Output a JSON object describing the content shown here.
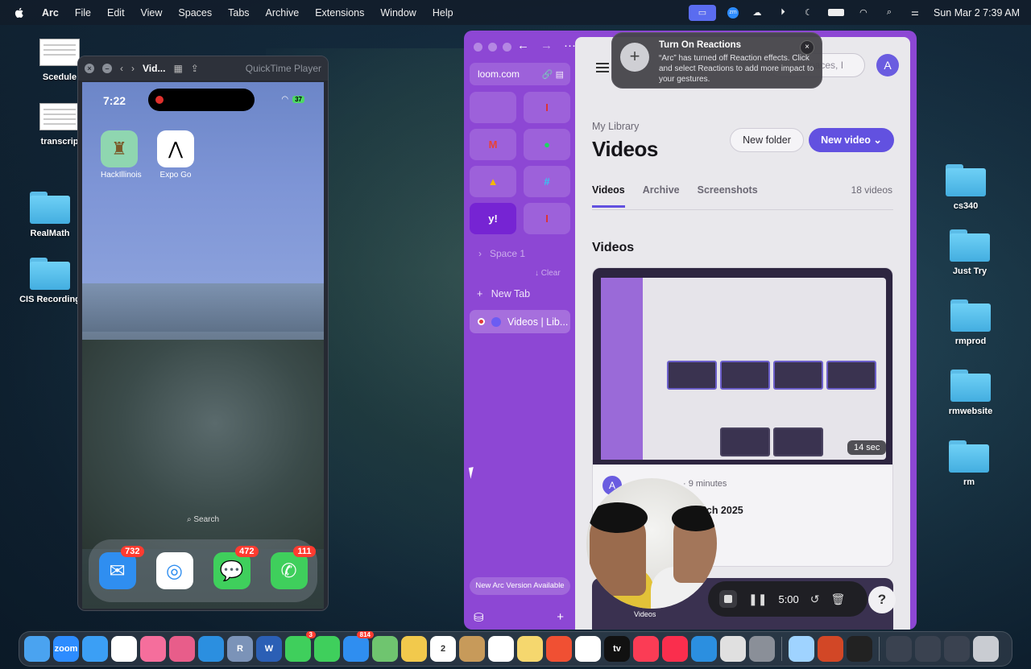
{
  "menubar": {
    "app": "Arc",
    "items": [
      "File",
      "Edit",
      "View",
      "Spaces",
      "Tabs",
      "Archive",
      "Extensions",
      "Window",
      "Help"
    ],
    "clock": "Sun Mar 2  7:39 AM",
    "status_icons": [
      "screen-share-icon",
      "zoom-icon",
      "siri-icon",
      "play-icon",
      "focus-icon",
      "battery-icon",
      "wifi-icon",
      "search-icon",
      "control-center-icon"
    ]
  },
  "desktop": {
    "left_icons": [
      {
        "label": "Scedule",
        "kind": "doc"
      },
      {
        "label": "transcrip",
        "kind": "doc"
      },
      {
        "label": "RealMath",
        "kind": "folder"
      },
      {
        "label": "CIS Recording",
        "kind": "folder"
      }
    ],
    "right_icons": [
      {
        "label": "cs340"
      },
      {
        "label": "Just Try"
      },
      {
        "label": "rmprod"
      },
      {
        "label": "rmwebsite"
      },
      {
        "label": "rm"
      }
    ]
  },
  "quicktime": {
    "title": "Vid...",
    "app": "QuickTime Player",
    "phone": {
      "time": "7:22",
      "battery": "37",
      "apps": [
        {
          "label": "HackIllinois",
          "icon": "hackillinois-icon",
          "color": "#8fd6b0"
        },
        {
          "label": "Expo Go",
          "icon": "expo-icon",
          "color": "#ffffff"
        }
      ],
      "search": "Search",
      "dock": [
        {
          "name": "mail-icon",
          "badge": "732",
          "color": "#2f8ef0"
        },
        {
          "name": "safari-icon",
          "badge": "",
          "color": "#ffffff"
        },
        {
          "name": "messages-icon",
          "badge": "472",
          "color": "#3fcf5c"
        },
        {
          "name": "phone-icon",
          "badge": "111",
          "color": "#3fcf5c"
        }
      ]
    }
  },
  "arc": {
    "url": "loom.com",
    "favorites": [
      {
        "name": "fav-1",
        "glyph": ""
      },
      {
        "name": "fav-hackillinois",
        "glyph": "I",
        "color": "#e0302c"
      },
      {
        "name": "fav-gmail",
        "glyph": "M",
        "color": "#e94235"
      },
      {
        "name": "fav-spotify",
        "glyph": "●",
        "color": "#1ed760"
      },
      {
        "name": "fav-drive",
        "glyph": "▲",
        "color": "#f6b700"
      },
      {
        "name": "fav-slack",
        "glyph": "#",
        "color": "#36c5f0"
      },
      {
        "name": "fav-yahoo",
        "glyph": "y!",
        "color": "#6001d2"
      },
      {
        "name": "fav-hackillinois-2",
        "glyph": "I",
        "color": "#e0302c"
      }
    ],
    "space": "Space 1",
    "clear": "↓ Clear",
    "new_tab": "New Tab",
    "active_tab": "Videos | Lib...",
    "new_version": "New Arc Version Available"
  },
  "loom": {
    "search_placeholder": "paces, I",
    "avatar": "A",
    "breadcrumb": "My Library",
    "title": "Videos",
    "new_folder": "New folder",
    "new_video": "New video",
    "tabs": [
      "Videos",
      "Archive",
      "Screenshots"
    ],
    "count": "18 videos",
    "section": "Videos",
    "card": {
      "duration": "14 sec",
      "avatar": "A",
      "meta": "· 9 minutes",
      "title": "rch 2025"
    },
    "card2_label": "Videos"
  },
  "notification": {
    "title": "Turn On Reactions",
    "body": "“Arc” has turned off Reaction effects. Click  and select Reactions to add more impact to your gestures."
  },
  "recorder": {
    "time": "5:00",
    "help": "?"
  },
  "dock": [
    {
      "name": "finder-icon",
      "color": "#4aa3f0",
      "glyph": ""
    },
    {
      "name": "zoom-icon",
      "color": "#2d8cff",
      "glyph": "zoom"
    },
    {
      "name": "safari-icon",
      "color": "#3b9ff5",
      "glyph": ""
    },
    {
      "name": "chrome-icon",
      "color": "#ffffff",
      "glyph": ""
    },
    {
      "name": "arc-icon",
      "color": "#f56e9c",
      "glyph": ""
    },
    {
      "name": "launchpad-icon",
      "color": "#e85d8a",
      "glyph": ""
    },
    {
      "name": "vscode-icon",
      "color": "#2b8fe0",
      "glyph": ""
    },
    {
      "name": "r-icon",
      "color": "#7b93b8",
      "glyph": "R"
    },
    {
      "name": "word-icon",
      "color": "#2b5fb5",
      "glyph": "W"
    },
    {
      "name": "facetime-icon",
      "color": "#3fcf5c",
      "glyph": "",
      "badge": "3"
    },
    {
      "name": "messages-icon",
      "color": "#3fcf5c",
      "glyph": ""
    },
    {
      "name": "mail-icon",
      "color": "#2f8ef0",
      "glyph": "",
      "badge": "814"
    },
    {
      "name": "maps-icon",
      "color": "#6fc56f",
      "glyph": ""
    },
    {
      "name": "photos-icon",
      "color": "#f2c94c",
      "glyph": ""
    },
    {
      "name": "calendar-icon",
      "color": "#ffffff",
      "glyph": "2"
    },
    {
      "name": "contacts-icon",
      "color": "#c79a5a",
      "glyph": ""
    },
    {
      "name": "reminders-icon",
      "color": "#ffffff",
      "glyph": ""
    },
    {
      "name": "notes-icon",
      "color": "#f5d76e",
      "glyph": ""
    },
    {
      "name": "git-icon",
      "color": "#f05033",
      "glyph": ""
    },
    {
      "name": "freeform-icon",
      "color": "#ffffff",
      "glyph": ""
    },
    {
      "name": "appletv-icon",
      "color": "#111111",
      "glyph": "tv"
    },
    {
      "name": "music-icon",
      "color": "#fb3c55",
      "glyph": ""
    },
    {
      "name": "news-icon",
      "color": "#fa2e4d",
      "glyph": ""
    },
    {
      "name": "appstore-icon",
      "color": "#2b8fe0",
      "glyph": ""
    },
    {
      "name": "simulator-icon",
      "color": "#e0e0e0",
      "glyph": ""
    },
    {
      "name": "settings-icon",
      "color": "#8a8f98",
      "glyph": ""
    },
    {
      "name": "sep",
      "color": "",
      "glyph": ""
    },
    {
      "name": "preview-icon",
      "color": "#9fd3ff",
      "glyph": ""
    },
    {
      "name": "powerpoint-icon",
      "color": "#d24726",
      "glyph": ""
    },
    {
      "name": "recording-icon",
      "color": "#222222",
      "glyph": ""
    },
    {
      "name": "sep",
      "color": "",
      "glyph": ""
    },
    {
      "name": "window-thumb-1",
      "color": "#3a4250",
      "glyph": ""
    },
    {
      "name": "window-thumb-2",
      "color": "#3a4250",
      "glyph": ""
    },
    {
      "name": "window-thumb-3",
      "color": "#3a4250",
      "glyph": ""
    },
    {
      "name": "trash-icon",
      "color": "#c9ccd2",
      "glyph": ""
    }
  ]
}
